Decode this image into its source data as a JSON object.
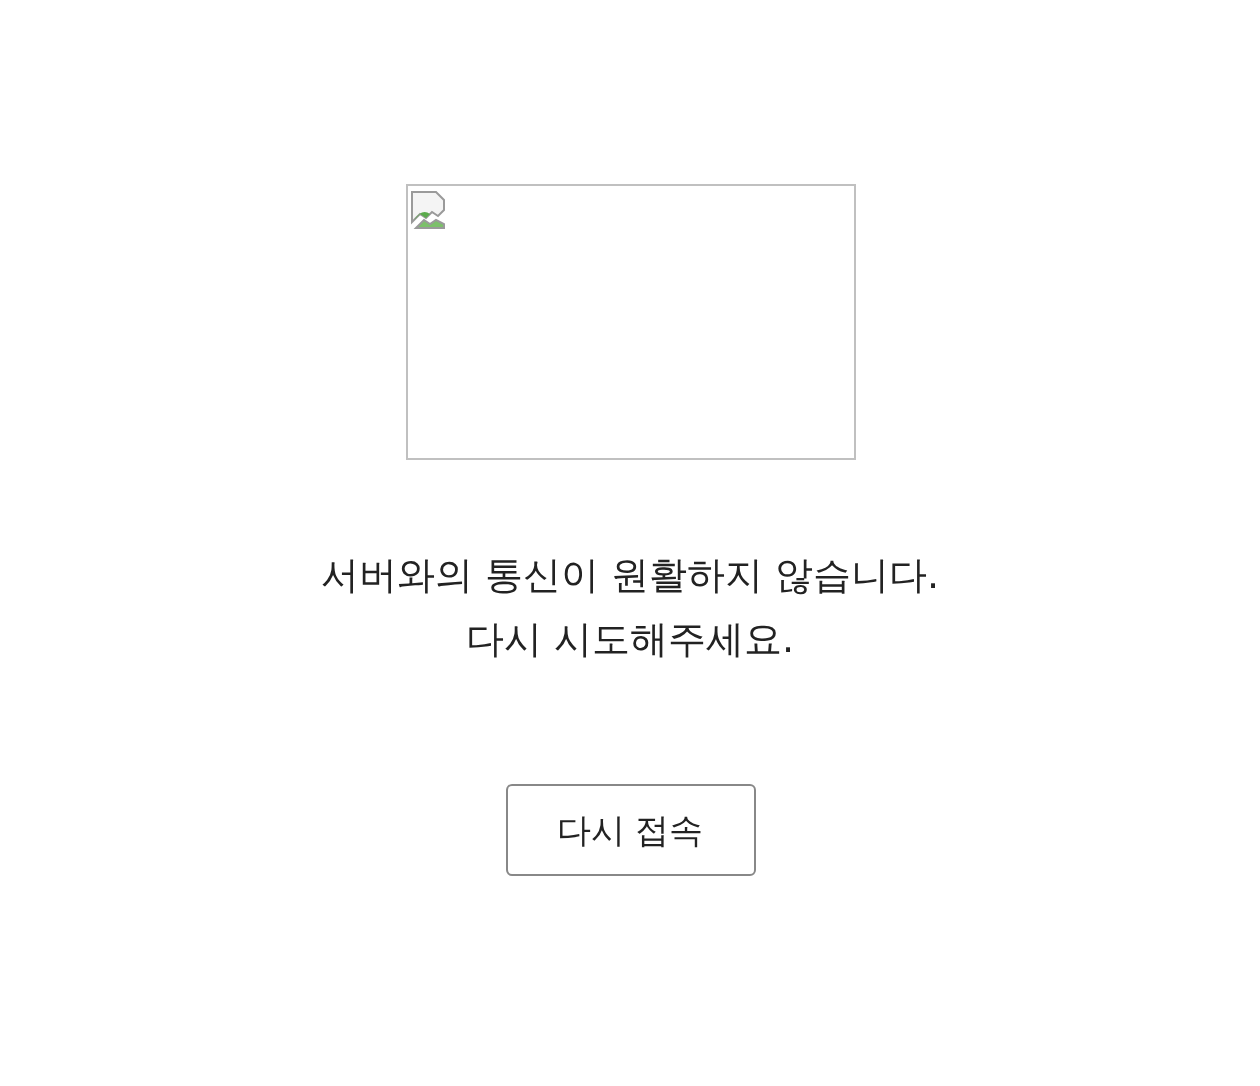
{
  "message": [
    "서버와의 통신이 원활하지 않습니다.",
    "다시 시도해주세요."
  ],
  "button": {
    "label": "다시 접속"
  }
}
